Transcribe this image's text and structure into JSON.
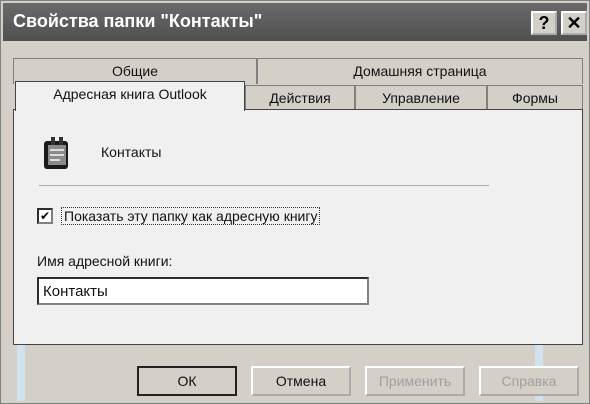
{
  "window": {
    "title": "Свойства папки \"Контакты\"",
    "help_glyph": "?",
    "close_glyph": "✕"
  },
  "tabs": {
    "row1": [
      "Общие",
      "Домашняя страница"
    ],
    "row2": [
      "Адресная книга Outlook",
      "Действия",
      "Управление",
      "Формы"
    ],
    "active": "Адресная книга Outlook"
  },
  "folder": {
    "icon": "contacts-folder-icon",
    "name": "Контакты"
  },
  "options": {
    "show_as_address_book_label": "Показать эту папку как адресную книгу",
    "show_as_address_book_checked": true,
    "check_glyph": "✔"
  },
  "address_book_name": {
    "label": "Имя адресной книги:",
    "value": "Контакты"
  },
  "buttons": {
    "ok": "ОК",
    "cancel": "Отмена",
    "apply": "Применить",
    "help": "Справка"
  }
}
